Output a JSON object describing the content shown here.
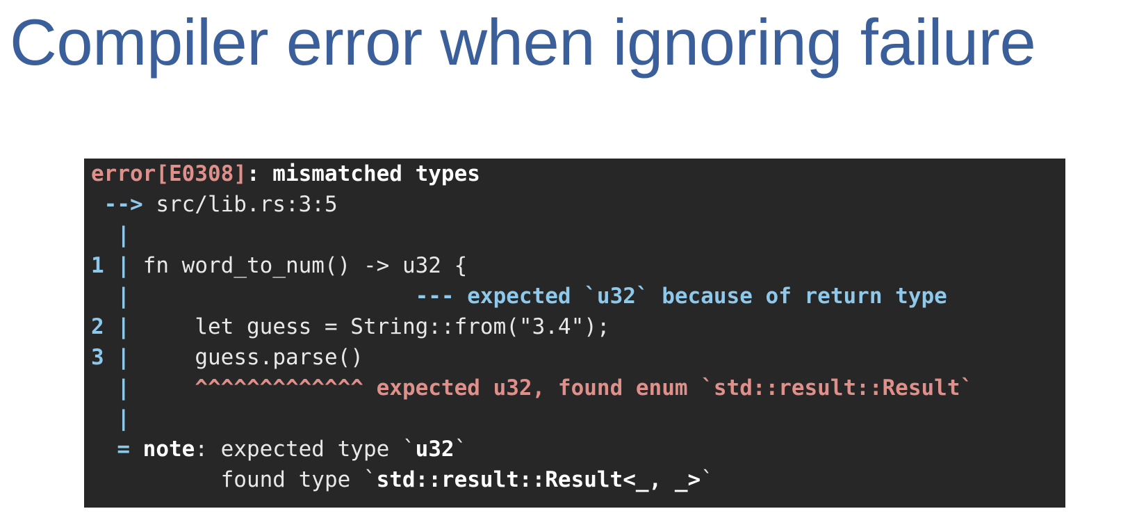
{
  "slide": {
    "title": "Compiler error when ignoring failure"
  },
  "terminal": {
    "error_code": "error[E0308]",
    "error_sep": ": ",
    "error_message": "mismatched types",
    "arrow": " -->",
    "location": " src/lib.rs:3:5",
    "pipe": "|",
    "line1": {
      "number": "1",
      "code": " fn word_to_num() -> u32 {"
    },
    "line1_annotation": {
      "indent": "                      ",
      "marker": "--- expected `u32` because of return type"
    },
    "line2": {
      "number": "2",
      "code": "     let guess = String::from(\"3.4\");"
    },
    "line3": {
      "number": "3",
      "code": "     guess.parse()"
    },
    "line3_annotation": {
      "indent": "     ",
      "marker": "^^^^^^^^^^^^^ expected u32, found enum `std::result::Result`"
    },
    "note": {
      "equals": "=",
      "label": "note",
      "colon": ": expected type `",
      "expected_type": "u32",
      "close1": "`",
      "found_prefix": "          found type `",
      "found_type": "std::result::Result<_, _>",
      "close2": "`"
    }
  },
  "colors": {
    "title": "#3b5f9a",
    "terminal_bg": "#272727",
    "error_red": "#e0908a",
    "annotation_blue": "#8ec8ea",
    "text": "#e8e8e8"
  }
}
